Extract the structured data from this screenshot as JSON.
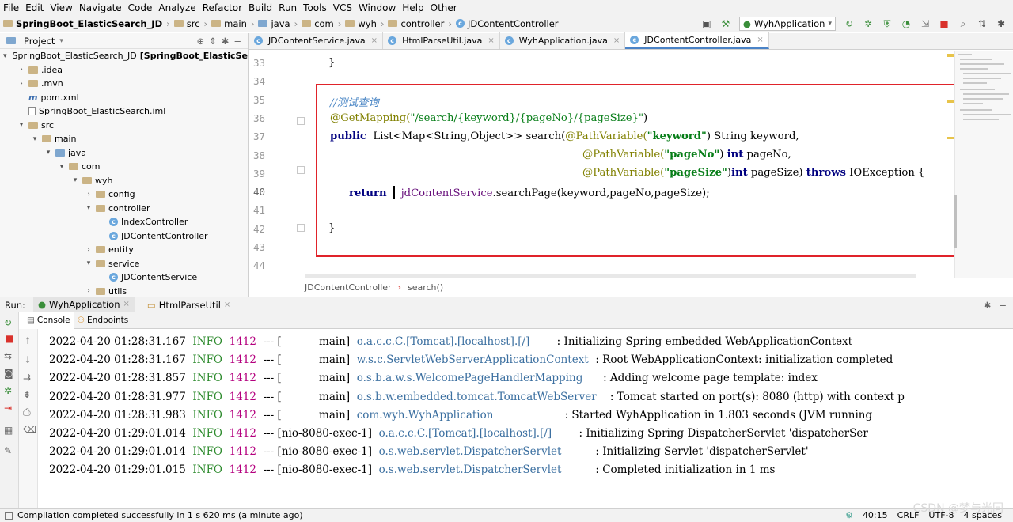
{
  "menu": [
    "File",
    "Edit",
    "View",
    "Navigate",
    "Code",
    "Analyze",
    "Refactor",
    "Build",
    "Run",
    "Tools",
    "VCS",
    "Window",
    "Help",
    "Other"
  ],
  "nav": {
    "project": "SpringBoot_ElasticSearch_JD",
    "crumbs": [
      "src",
      "main",
      "java",
      "com",
      "wyh",
      "controller"
    ],
    "file": "JDContentController",
    "run_config": "WyhApplication"
  },
  "project_panel": {
    "title": "Project",
    "rows": [
      {
        "label": "SpringBoot_ElasticSearch_JD",
        "suffix": "[SpringBoot_ElasticSearch]",
        "arrow": "▾",
        "icon": "folder",
        "indent": 0
      },
      {
        "label": ".idea",
        "arrow": "›",
        "icon": "folder",
        "indent": 1
      },
      {
        "label": ".mvn",
        "arrow": "›",
        "icon": "folder",
        "indent": 1
      },
      {
        "label": "pom.xml",
        "arrow": "",
        "icon": "maven",
        "indent": 1
      },
      {
        "label": "SpringBoot_ElasticSearch.iml",
        "arrow": "",
        "icon": "file",
        "indent": 1
      },
      {
        "label": "src",
        "arrow": "▾",
        "icon": "folder",
        "indent": 1
      },
      {
        "label": "main",
        "arrow": "▾",
        "icon": "folder",
        "indent": 2
      },
      {
        "label": "java",
        "arrow": "▾",
        "icon": "folderblue",
        "indent": 3
      },
      {
        "label": "com",
        "arrow": "▾",
        "icon": "folder",
        "indent": 4
      },
      {
        "label": "wyh",
        "arrow": "▾",
        "icon": "folder",
        "indent": 5
      },
      {
        "label": "config",
        "arrow": "›",
        "icon": "folder",
        "indent": 6
      },
      {
        "label": "controller",
        "arrow": "▾",
        "icon": "folder",
        "indent": 6
      },
      {
        "label": "IndexController",
        "arrow": "",
        "icon": "class",
        "indent": 7
      },
      {
        "label": "JDContentController",
        "arrow": "",
        "icon": "class",
        "indent": 7
      },
      {
        "label": "entity",
        "arrow": "›",
        "icon": "folder",
        "indent": 6
      },
      {
        "label": "service",
        "arrow": "▾",
        "icon": "folder",
        "indent": 6
      },
      {
        "label": "JDContentService",
        "arrow": "",
        "icon": "class",
        "indent": 7
      },
      {
        "label": "utils",
        "arrow": "›",
        "icon": "folder",
        "indent": 6
      }
    ]
  },
  "editor_tabs": [
    {
      "label": "JDContentService.java",
      "active": false
    },
    {
      "label": "HtmlParseUtil.java",
      "active": false
    },
    {
      "label": "WyhApplication.java",
      "active": false
    },
    {
      "label": "JDContentController.java",
      "active": true
    }
  ],
  "line_numbers": [
    "33",
    "34",
    "35",
    "36",
    "37",
    "38",
    "39",
    "40",
    "41",
    "42",
    "43",
    "44"
  ],
  "code": {
    "l33": "}",
    "l35": "//测试查询",
    "l36a": "@GetMapping(",
    "l36b": "\"/search/{keyword}/{pageNo}/{pageSize}\"",
    "l36c": ")",
    "l37a": "public",
    "l37b": "  List<Map<String,Object>> search(",
    "l37c": "@PathVariable(",
    "l37d": "\"keyword\"",
    "l37e": ") String keyword,",
    "l38a": "@PathVariable(",
    "l38b": "\"pageNo\"",
    "l38c": ") ",
    "l38d": "int",
    "l38e": " pageNo,",
    "l39a": "@PathVariable(",
    "l39b": "\"pageSize\"",
    "l39c": ")",
    "l39d": "int",
    "l39e": " pageSize) ",
    "l39f": "throws",
    "l39g": " IOException {",
    "l40a": "return",
    "l40b": "jdContentService",
    "l40c": ".searchPage(keyword,pageNo,pageSize);",
    "l42": "}"
  },
  "editor_breadcrumb": {
    "a": "JDContentController",
    "b": "search()"
  },
  "run": {
    "label": "Run:",
    "tabs": [
      "WyhApplication",
      "HtmlParseUtil"
    ]
  },
  "console_tabs": {
    "console": "Console",
    "endpoints": "Endpoints"
  },
  "logs": [
    {
      "ts": "2022-04-20 01:28:31.167",
      "lvl": "INFO",
      "pid": "1412",
      "sep": "--- [",
      "thr": "           main]",
      "src": "o.a.c.c.C.[Tomcat].[localhost].[/]      ",
      "msg": ": Initializing Spring embedded WebApplicationContext"
    },
    {
      "ts": "2022-04-20 01:28:31.167",
      "lvl": "INFO",
      "pid": "1412",
      "sep": "--- [",
      "thr": "           main]",
      "src": "w.s.c.ServletWebServerApplicationContext",
      "msg": ": Root WebApplicationContext: initialization completed"
    },
    {
      "ts": "2022-04-20 01:28:31.857",
      "lvl": "INFO",
      "pid": "1412",
      "sep": "--- [",
      "thr": "           main]",
      "src": "o.s.b.a.w.s.WelcomePageHandlerMapping    ",
      "msg": ": Adding welcome page template: index"
    },
    {
      "ts": "2022-04-20 01:28:31.977",
      "lvl": "INFO",
      "pid": "1412",
      "sep": "--- [",
      "thr": "           main]",
      "src": "o.s.b.w.embedded.tomcat.TomcatWebServer  ",
      "msg": ": Tomcat started on port(s): 8080 (http) with context p"
    },
    {
      "ts": "2022-04-20 01:28:31.983",
      "lvl": "INFO",
      "pid": "1412",
      "sep": "--- [",
      "thr": "           main]",
      "src": "com.wyh.WyhApplication                   ",
      "msg": ": Started WyhApplication in 1.803 seconds (JVM running"
    },
    {
      "ts": "2022-04-20 01:29:01.014",
      "lvl": "INFO",
      "pid": "1412",
      "sep": "--- [",
      "thr": "nio-8080-exec-1]",
      "src": "o.a.c.c.C.[Tomcat].[localhost].[/]      ",
      "msg": ": Initializing Spring DispatcherServlet 'dispatcherSer"
    },
    {
      "ts": "2022-04-20 01:29:01.014",
      "lvl": "INFO",
      "pid": "1412",
      "sep": "--- [",
      "thr": "nio-8080-exec-1]",
      "src": "o.s.web.servlet.DispatcherServlet        ",
      "msg": ": Initializing Servlet 'dispatcherServlet'"
    },
    {
      "ts": "2022-04-20 01:29:01.015",
      "lvl": "INFO",
      "pid": "1412",
      "sep": "--- [",
      "thr": "nio-8080-exec-1]",
      "src": "o.s.web.servlet.DispatcherServlet        ",
      "msg": ": Completed initialization in 1 ms"
    }
  ],
  "status": {
    "message": "Compilation completed successfully in 1 s 620 ms (a minute ago)",
    "pos": "40:15",
    "crlf": "CRLF",
    "enc": "UTF-8",
    "indent": "4 spaces"
  },
  "watermark": "CSDN @梦与光同",
  "colors": {
    "keyword": "#000080",
    "string": "#067d17",
    "annotation": "#808000",
    "comment": "#8c8c8c",
    "field": "#660e7a",
    "info": "#2e8b2e",
    "pid": "#b4007e",
    "logsrc": "#3b6fa0",
    "highlight": "#e0232a"
  }
}
